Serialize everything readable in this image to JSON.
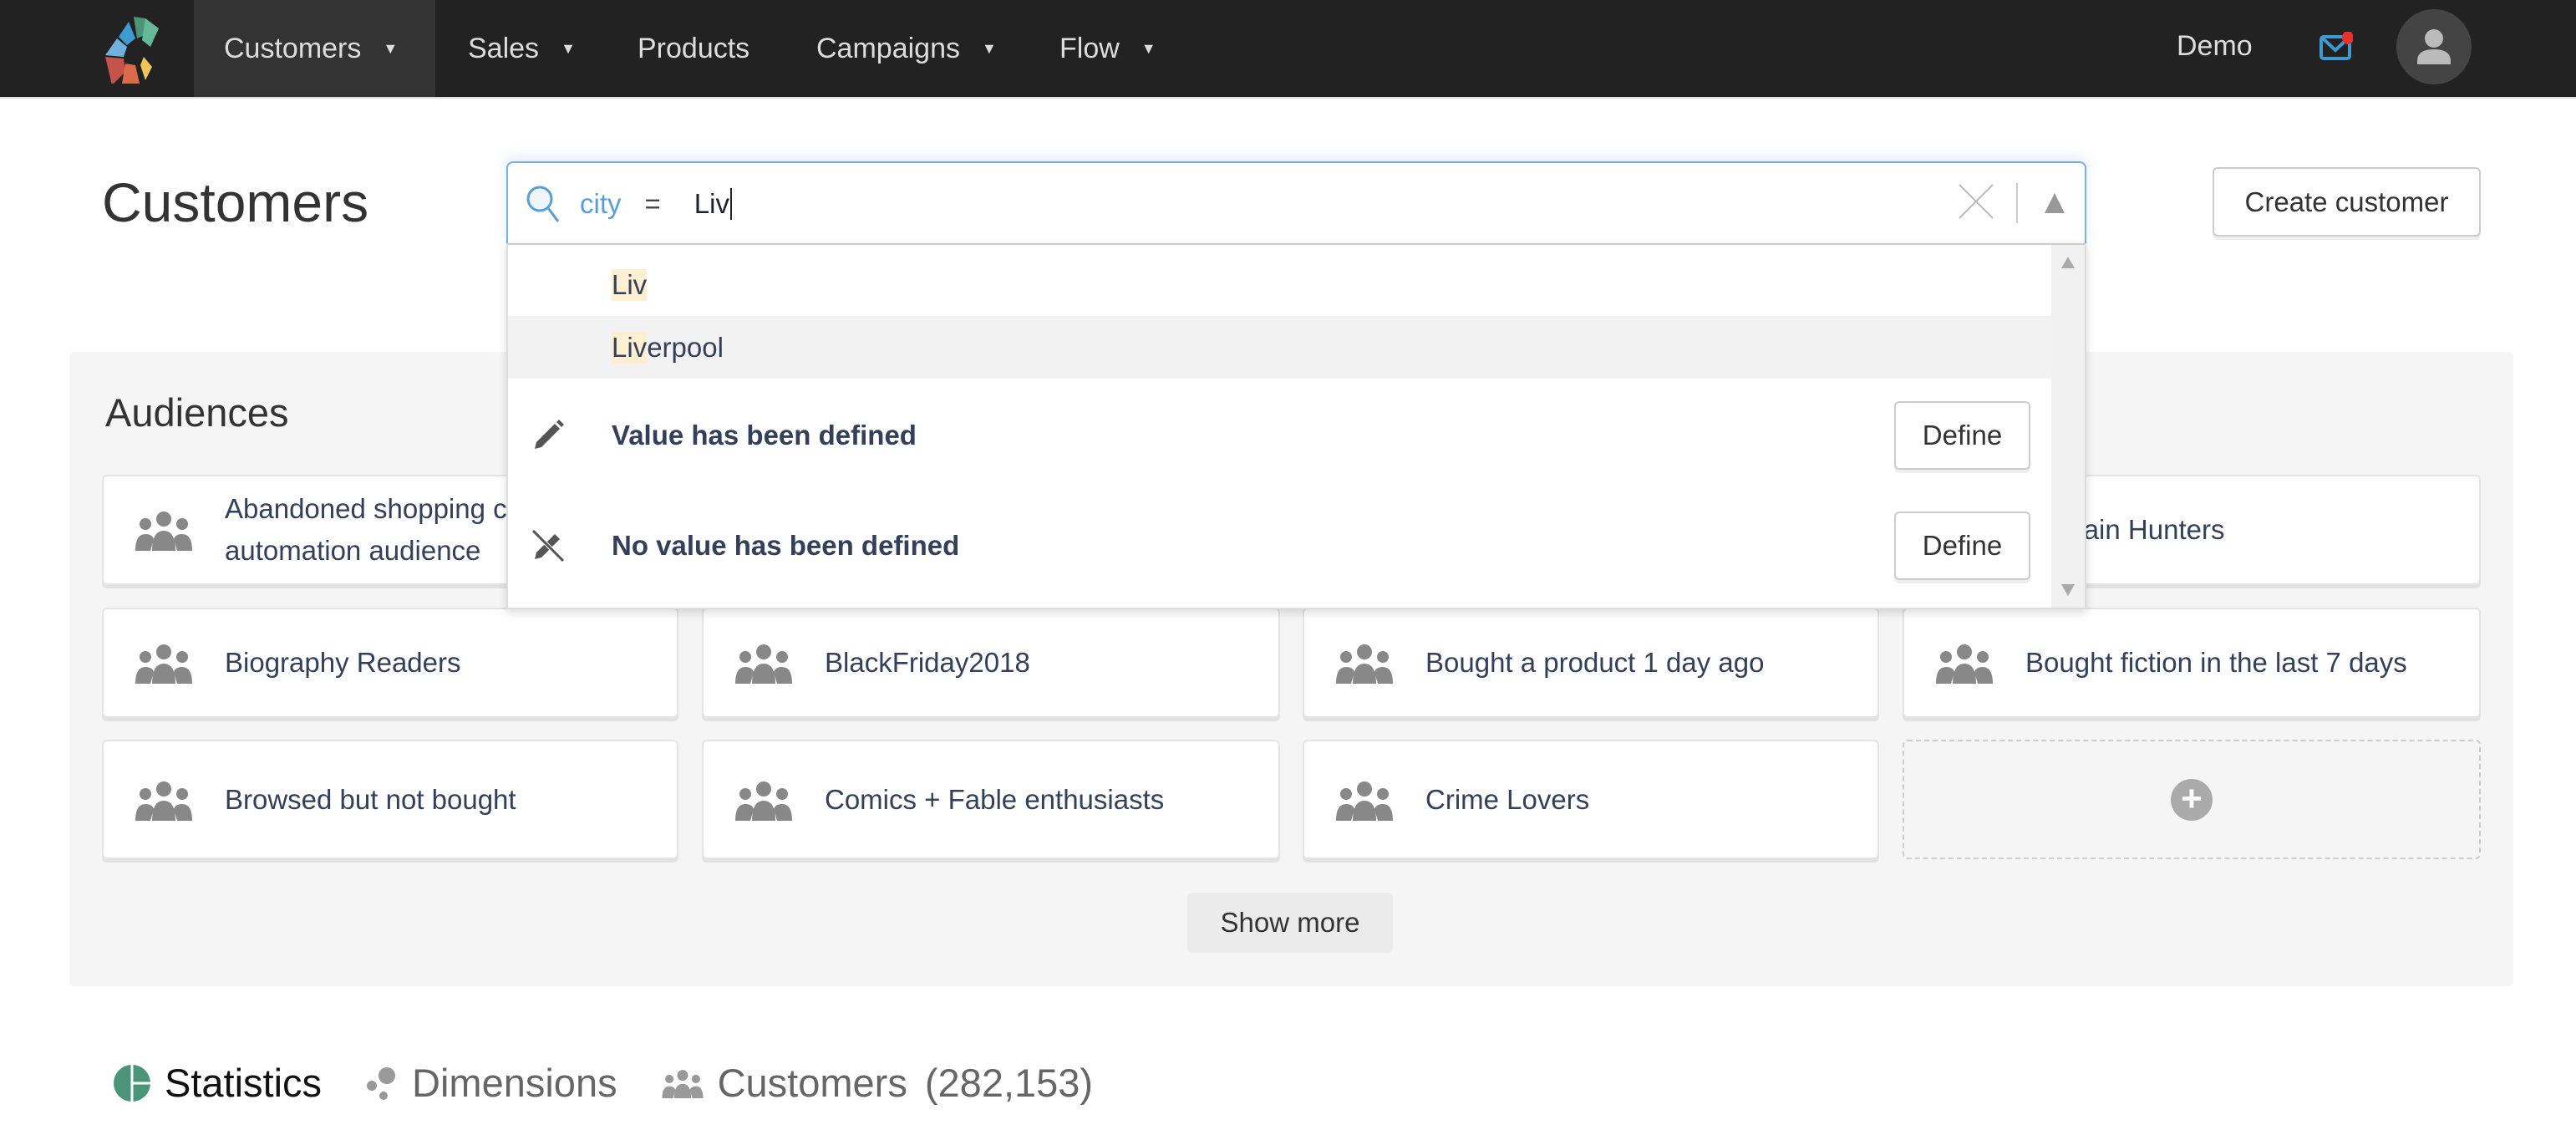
{
  "nav": {
    "items": [
      {
        "label": "Customers",
        "caret": true,
        "active": true
      },
      {
        "label": "Sales",
        "caret": true
      },
      {
        "label": "Products",
        "caret": false
      },
      {
        "label": "Campaigns",
        "caret": true
      },
      {
        "label": "Flow",
        "caret": true
      }
    ],
    "account": "Demo",
    "icons": [
      "logo",
      "mail-icon",
      "notification-dot",
      "user-avatar-icon"
    ],
    "colors": {
      "bar": "#222222",
      "active": "#333333",
      "mail": "#3d9bd1",
      "notification": "#e8312a"
    }
  },
  "page_title": "Customers",
  "search": {
    "field": "city",
    "operator": "=",
    "value": "Liv",
    "suggestions": [
      {
        "match": "Liv",
        "rest": ""
      },
      {
        "match": "Liv",
        "rest": "erpool"
      }
    ],
    "definitions": [
      {
        "icon": "pencil-icon",
        "label": "Value has been defined",
        "button": "Define"
      },
      {
        "icon": "pencil-off-icon",
        "label": "No value has been defined",
        "button": "Define"
      }
    ]
  },
  "create_button": "Create customer",
  "audiences": {
    "title": "Audiences",
    "cards": [
      "Abandoned shopping cart automation audience",
      "",
      "",
      "Bargain Hunters",
      "Biography Readers",
      "BlackFriday2018",
      "Bought a product 1 day ago",
      "Bought fiction in the last 7 days",
      "Browsed but not bought",
      "Comics + Fable enthusiasts",
      "Crime Lovers"
    ],
    "show_more": "Show more"
  },
  "tabs": [
    {
      "icon": "pie-chart-icon",
      "label": "Statistics",
      "active": true
    },
    {
      "icon": "dimensions-icon",
      "label": "Dimensions"
    },
    {
      "icon": "people-icon",
      "label": "Customers",
      "count": "(282,153)"
    }
  ],
  "accent": "#4a9478"
}
